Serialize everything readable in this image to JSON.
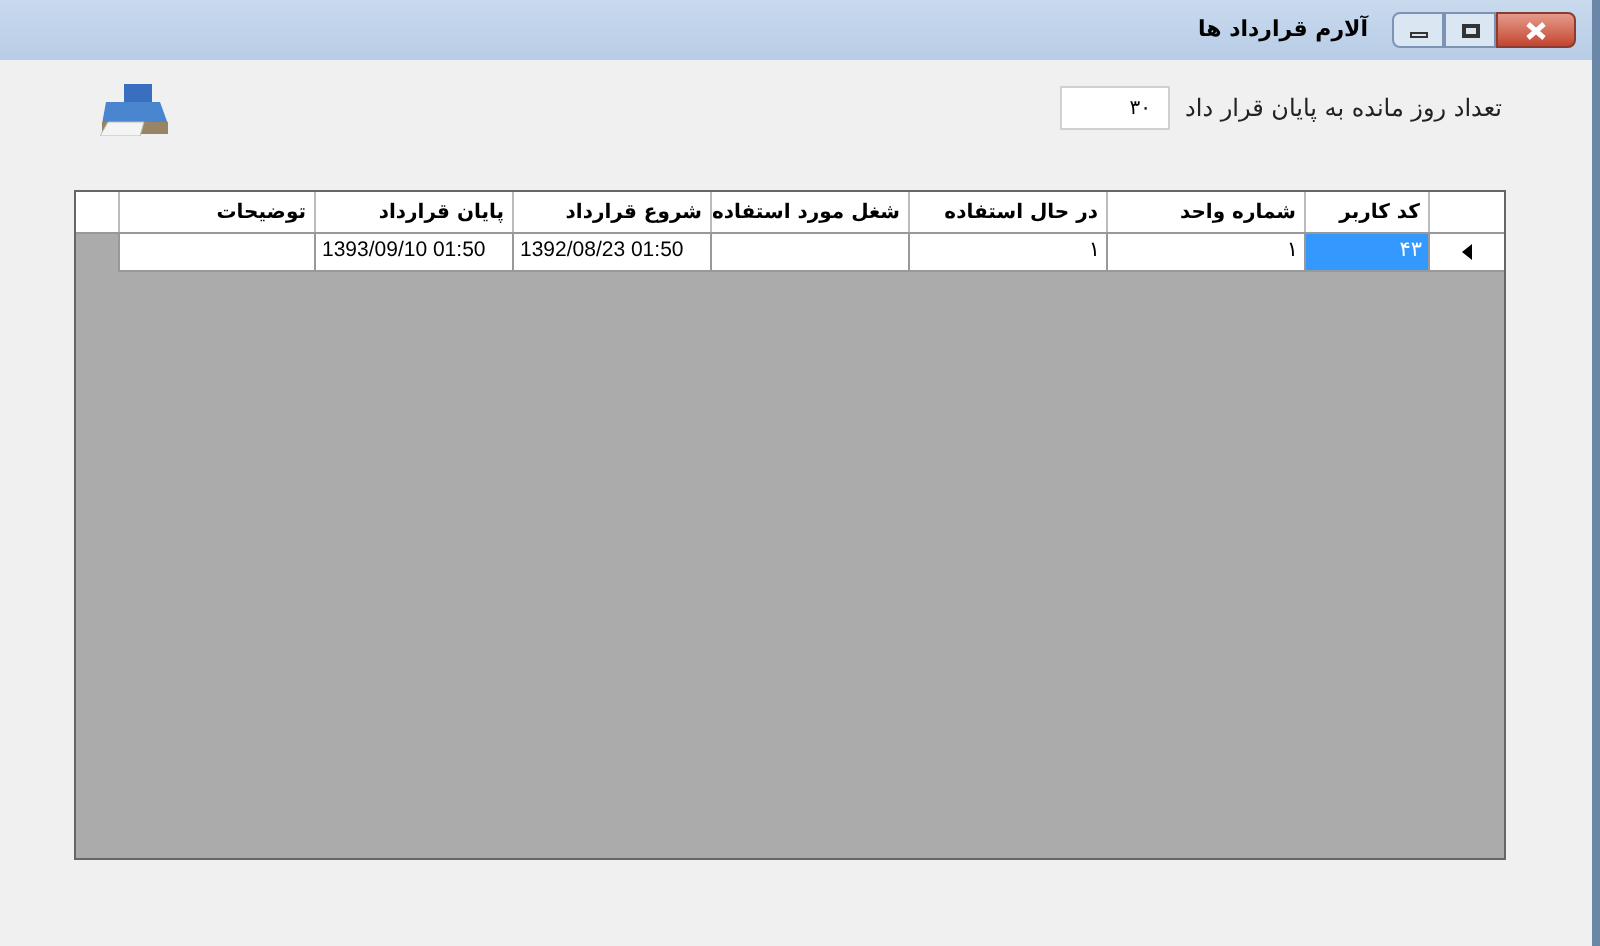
{
  "window": {
    "title": "آلارم قرارداد ها"
  },
  "days_field": {
    "label": "تعداد روز مانده به پایان قرار داد",
    "value": "۳۰"
  },
  "table": {
    "columns": [
      "کد کاربر",
      "شماره واحد",
      "در حال استفاده",
      "شغل مورد استفاده",
      "شروع قرارداد",
      "پایان قرارداد",
      "توضیحات"
    ],
    "rows": [
      {
        "current": true,
        "cells": [
          {
            "text": "۴۳",
            "selected": true
          },
          {
            "text": "۱",
            "selected": false
          },
          {
            "text": "۱",
            "selected": false
          },
          {
            "text": "",
            "selected": false
          },
          {
            "text": "1392/08/23 01:50",
            "selected": false
          },
          {
            "text": "1393/09/10 01:50",
            "selected": false
          },
          {
            "text": "",
            "selected": false
          }
        ]
      }
    ]
  }
}
